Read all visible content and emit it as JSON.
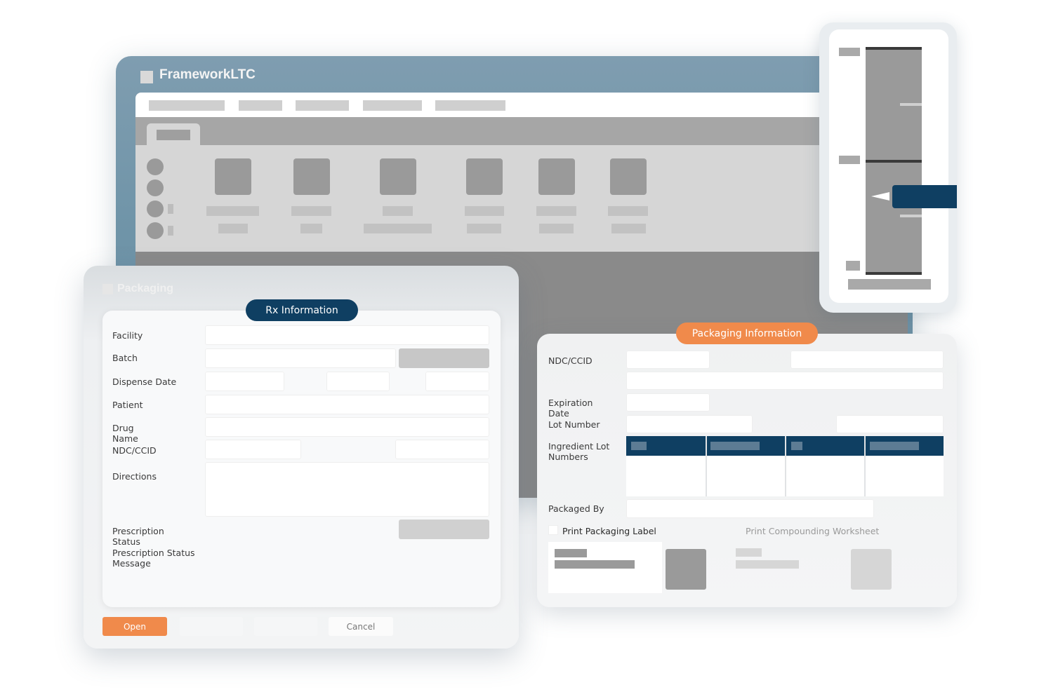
{
  "app": {
    "title": "FrameworkLTC"
  },
  "dialog": {
    "title": "Packaging",
    "rx_section": "Rx Information",
    "labels": {
      "facility": "Facility",
      "batch": "Batch",
      "dispense_date": "Dispense Date",
      "patient": "Patient",
      "drug_name": "Drug\nName",
      "ndc_ccid": "NDC/CCID",
      "directions": "Directions",
      "prescription_status": "Prescription\nStatus",
      "prescription_status_message": "Prescription Status\nMessage"
    },
    "buttons": {
      "open": "Open",
      "cancel": "Cancel"
    }
  },
  "packaging_info": {
    "section": "Packaging Information",
    "labels": {
      "ndc_ccid": "NDC/CCID",
      "expiration_date": "Expiration\nDate",
      "lot_number": "Lot Number",
      "ingredient_lot_numbers": "Ingredient Lot\nNumbers",
      "packaged_by": "Packaged By"
    },
    "print_packaging_label": "Print Packaging Label",
    "print_compounding_worksheet": "Print Compounding Worksheet"
  },
  "colors": {
    "navy": "#0f3f62",
    "orange": "#f08a4b",
    "steel": "#6f94a8"
  }
}
